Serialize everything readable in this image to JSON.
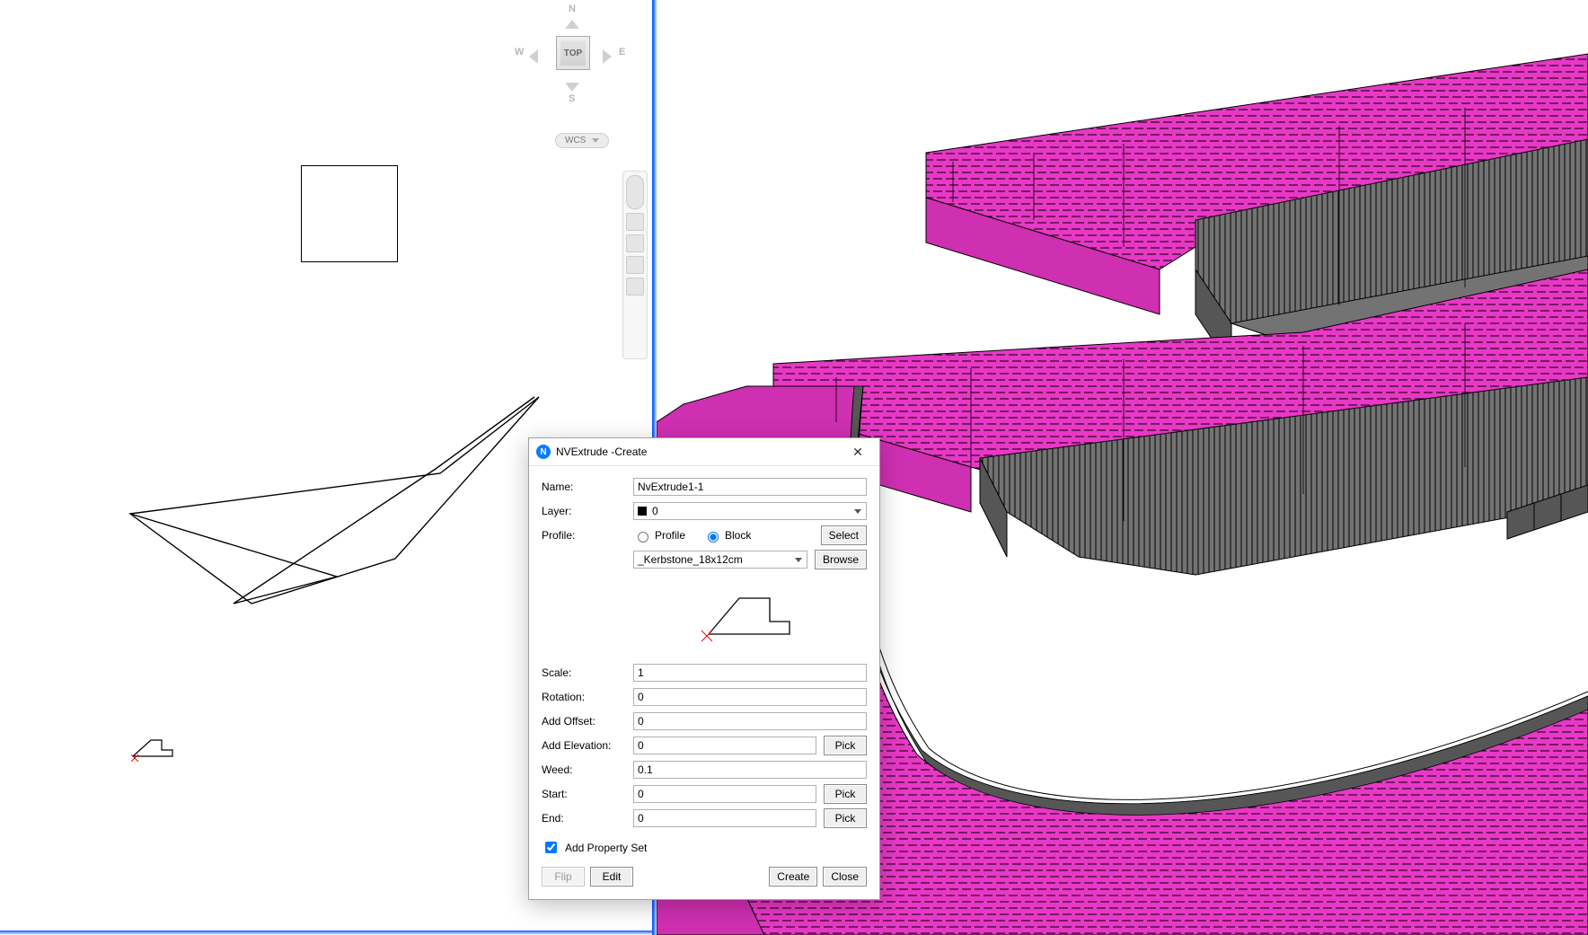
{
  "viewcube": {
    "N": "N",
    "S": "S",
    "E": "E",
    "W": "W",
    "face": "TOP",
    "wcs": "WCS"
  },
  "dialog": {
    "title": "NVExtrude -Create",
    "labels": {
      "name": "Name:",
      "layer": "Layer:",
      "profile": "Profile:",
      "scale": "Scale:",
      "rotation": "Rotation:",
      "add_offset": "Add Offset:",
      "add_elevation": "Add Elevation:",
      "weed": "Weed:",
      "start": "Start:",
      "end": "End:",
      "add_prop_set": "Add Property Set"
    },
    "values": {
      "name": "NvExtrude1-1",
      "layer": "0",
      "profile_radio_profile": "Profile",
      "profile_radio_block": "Block",
      "profile_mode": "Block",
      "block_name": "_Kerbstone_18x12cm",
      "scale": "1",
      "rotation": "0",
      "add_offset": "0",
      "add_elevation": "0",
      "weed": "0.1",
      "start": "0",
      "end": "0",
      "add_prop_set_checked": true
    },
    "buttons": {
      "select": "Select",
      "browse": "Browse",
      "pick": "Pick",
      "flip": "Flip",
      "edit": "Edit",
      "create": "Create",
      "close": "Close"
    }
  }
}
